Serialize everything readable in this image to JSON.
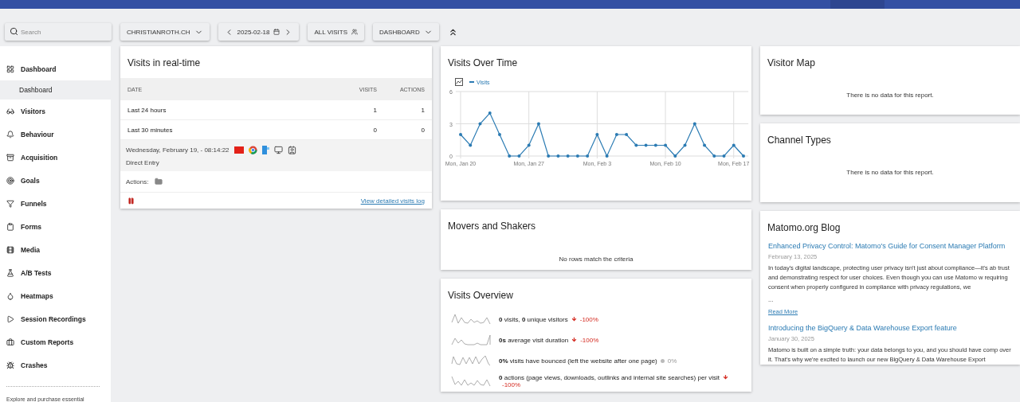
{
  "toolbar": {
    "search": {
      "placeholder": "Search"
    },
    "site": "CHRISTIANROTH.CH",
    "date": "2025-02-18",
    "segment": "ALL VISITS",
    "dashboard": "DASHBOARD"
  },
  "sidebar": {
    "items": [
      {
        "label": "Dashboard",
        "children": [
          {
            "label": "Dashboard",
            "selected": true
          }
        ]
      },
      {
        "label": "Visitors"
      },
      {
        "label": "Behaviour"
      },
      {
        "label": "Acquisition"
      },
      {
        "label": "Goals"
      },
      {
        "label": "Funnels"
      },
      {
        "label": "Forms"
      },
      {
        "label": "Media"
      },
      {
        "label": "A/B Tests"
      },
      {
        "label": "Heatmaps"
      },
      {
        "label": "Session Recordings"
      },
      {
        "label": "Custom Reports"
      },
      {
        "label": "Crashes"
      }
    ],
    "footer_text": "Explore and purchase essential"
  },
  "realtime": {
    "title": "Visits in real-time",
    "columns": [
      "DATE",
      "VISITS",
      "ACTIONS"
    ],
    "rows": [
      {
        "label": "Last 24 hours",
        "visits": "1",
        "actions": "1"
      },
      {
        "label": "Last 30 minutes",
        "visits": "0",
        "actions": "0"
      }
    ],
    "visit": {
      "time": "Wednesday, February 19, - 08:14:22",
      "referrer": "Direct Entry",
      "actions_label": "Actions:"
    },
    "link": "View detailed visits log"
  },
  "visits_over_time": {
    "title": "Visits Over Time",
    "chart_data": {
      "type": "line",
      "categories": [
        "Mon, Jan 20",
        null,
        null,
        null,
        null,
        null,
        null,
        "Mon, Jan 27",
        null,
        null,
        null,
        null,
        null,
        null,
        "Mon, Feb 3",
        null,
        null,
        null,
        null,
        null,
        null,
        "Mon, Feb 10",
        null,
        null,
        null,
        null,
        null,
        null,
        "Mon, Feb 17",
        null
      ],
      "series": [
        {
          "name": "Visits",
          "color": "#2b7bb3",
          "values": [
            2,
            1,
            3,
            4,
            2,
            0,
            0,
            1,
            3,
            0,
            0,
            0,
            0,
            0,
            2,
            0,
            2,
            2,
            1,
            1,
            1,
            1,
            0,
            1,
            3,
            1,
            0,
            0,
            1,
            0
          ]
        }
      ],
      "ylim": [
        0,
        6
      ],
      "yticks": [
        0,
        3,
        6
      ],
      "grid": true
    }
  },
  "movers": {
    "title": "Movers and Shakers",
    "message": "No rows match the criteria"
  },
  "overview": {
    "title": "Visits Overview",
    "rows": [
      {
        "text": "**0** visits, **0** unique visitors",
        "change": "-100%",
        "kind": "decrease"
      },
      {
        "text": "**0s** average visit duration",
        "change": "-100%",
        "kind": "decrease"
      },
      {
        "text": "**0%** visits have bounced (left the website after one page)",
        "change": "0%",
        "kind": "unchanged"
      },
      {
        "text": "**0** actions (page views, downloads, outlinks and internal site searches) per visit",
        "change": "-100%",
        "kind": "decrease"
      }
    ]
  },
  "visitor_map": {
    "title": "Visitor Map",
    "message": "There is no data for this report."
  },
  "channel_types": {
    "title": "Channel Types",
    "message": "There is no data for this report."
  },
  "blog": {
    "title": "Matomo.org Blog",
    "posts": [
      {
        "title": "Enhanced Privacy Control: Matomo's Guide for Consent Manager Platform",
        "date": "February 13, 2025",
        "excerpt": "In today's digital landscape, protecting user privacy isn't just about compliance—it's ab trust and demonstrating respect for user choices. Even though you can use Matomo w requiring consent when properly configured in compliance with privacy regulations, we",
        "more": "...",
        "read_more": "Read More"
      },
      {
        "title": "Introducing the BigQuery & Data Warehouse Export feature",
        "date": "January 30, 2025",
        "excerpt": "Matomo is built on a simple truth: your data belongs to you, and you should have comp over it. That's why we're excited to launch our new BigQuery & Data Warehouse Export"
      }
    ]
  }
}
